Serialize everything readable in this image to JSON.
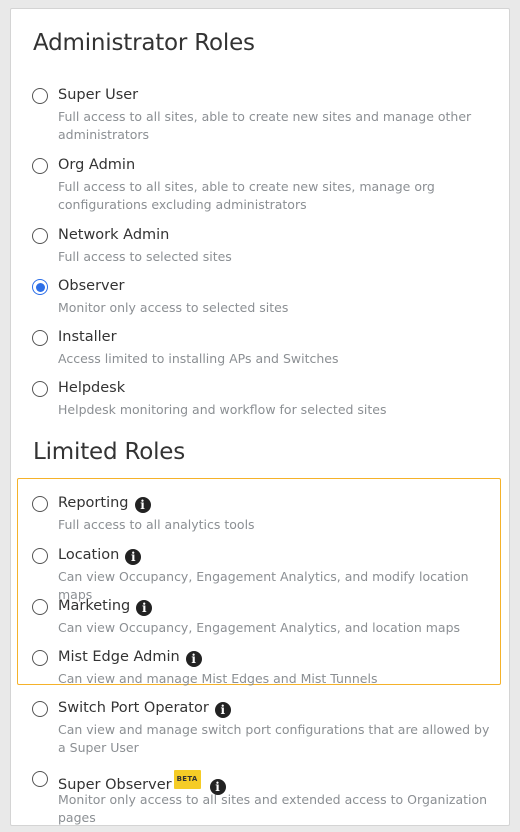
{
  "admin_section": {
    "title": "Administrator Roles",
    "roles": [
      {
        "label": "Super User",
        "desc": "Full access to all sites, able to create new sites and manage other administrators",
        "selected": false
      },
      {
        "label": "Org Admin",
        "desc": "Full access to all sites, able to create new sites, manage org configurations excluding administrators",
        "selected": false
      },
      {
        "label": "Network Admin",
        "desc": "Full access to selected sites",
        "selected": false
      },
      {
        "label": "Observer",
        "desc": "Monitor only access to selected sites",
        "selected": true
      },
      {
        "label": "Installer",
        "desc": "Access limited to installing APs and Switches",
        "selected": false
      },
      {
        "label": "Helpdesk",
        "desc": "Helpdesk monitoring and workflow for selected sites",
        "selected": false
      }
    ]
  },
  "limited_section": {
    "title": "Limited Roles",
    "roles": [
      {
        "label": "Reporting",
        "desc": "Full access to all analytics tools",
        "info_icon": "info-icon"
      },
      {
        "label": "Location",
        "desc": "Can view Occupancy, Engagement Analytics, and modify location maps",
        "info_icon": "info-icon"
      },
      {
        "label": "Marketing",
        "desc": "Can view Occupancy, Engagement Analytics, and location maps",
        "info_icon": "info-icon"
      },
      {
        "label": "Mist Edge Admin",
        "desc": "Can view and manage Mist Edges and Mist Tunnels",
        "info_icon": "info-icon"
      },
      {
        "label": "Switch Port Operator",
        "desc": "Can view and manage switch port configurations that are allowed by a Super User",
        "info_icon": "info-icon"
      },
      {
        "label": "Super Observer",
        "badge": "BETA",
        "desc": "Monitor only access to all sites and extended access to Organization pages",
        "info_icon": "info-icon"
      }
    ]
  },
  "colors": {
    "radio_selected": "#2d6fe8",
    "highlight_border": "#f5b22a",
    "beta_badge": "#f5cc26",
    "desc_text": "#8b8f93"
  }
}
